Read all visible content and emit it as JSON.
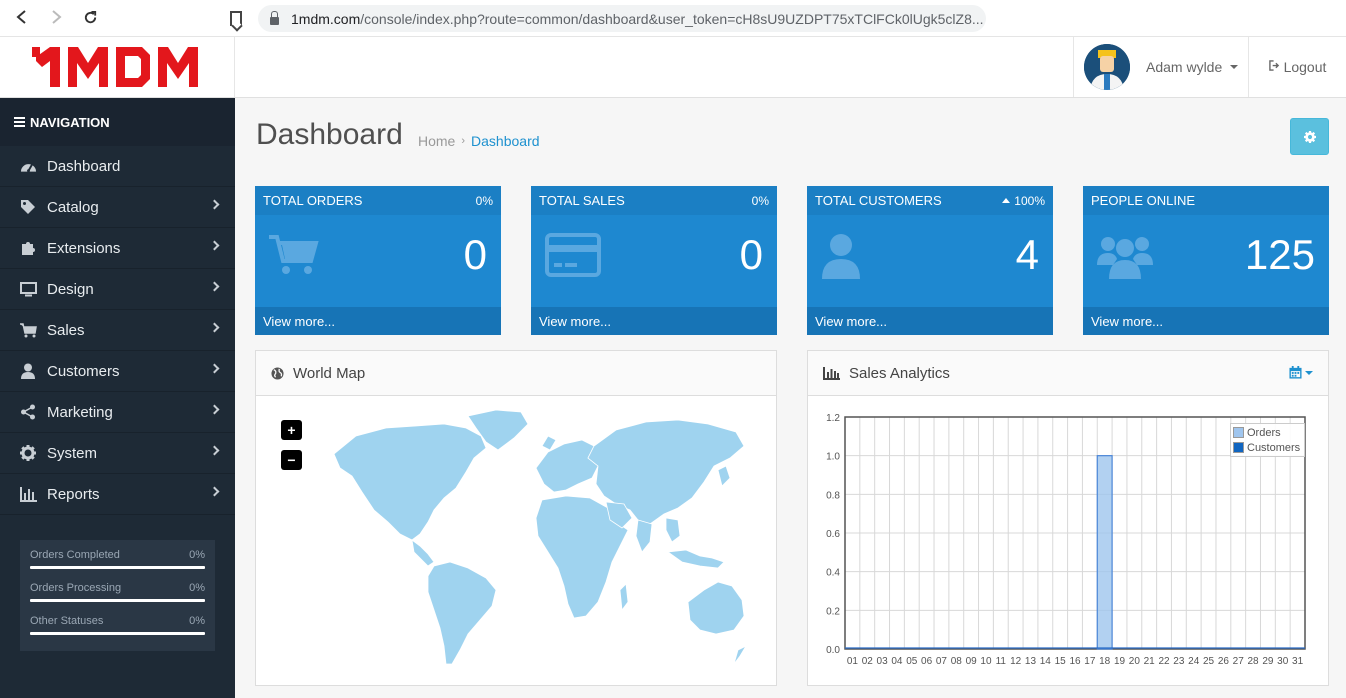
{
  "browser": {
    "url_host": "1mdm.com",
    "url_rest": "/console/index.php?route=common/dashboard&user_token=cH8sU9UZDPT75xTClFCk0lUgk5clZ8..."
  },
  "header": {
    "logo_text": "1MDM",
    "user_name": "Adam wylde",
    "logout_label": "Logout"
  },
  "sidebar": {
    "heading": "NAVIGATION",
    "items": [
      {
        "label": "Dashboard",
        "icon": "dashboard-icon"
      },
      {
        "label": "Catalog",
        "icon": "tags-icon"
      },
      {
        "label": "Extensions",
        "icon": "puzzle-icon"
      },
      {
        "label": "Design",
        "icon": "monitor-icon"
      },
      {
        "label": "Sales",
        "icon": "cart-icon"
      },
      {
        "label": "Customers",
        "icon": "user-icon"
      },
      {
        "label": "Marketing",
        "icon": "share-icon"
      },
      {
        "label": "System",
        "icon": "gear-icon"
      },
      {
        "label": "Reports",
        "icon": "bar-chart-icon"
      }
    ],
    "statuses": [
      {
        "label": "Orders Completed",
        "value": "0%"
      },
      {
        "label": "Orders Processing",
        "value": "0%"
      },
      {
        "label": "Other Statuses",
        "value": "0%"
      }
    ]
  },
  "main": {
    "title": "Dashboard",
    "breadcrumb": {
      "home": "Home",
      "current": "Dashboard"
    },
    "tiles": [
      {
        "title": "TOTAL ORDERS",
        "pct": "0%",
        "value": "0",
        "footer": "View more...",
        "icon": "cart-icon"
      },
      {
        "title": "TOTAL SALES",
        "pct": "0%",
        "value": "0",
        "footer": "View more...",
        "icon": "credit-card-icon"
      },
      {
        "title": "TOTAL CUSTOMERS",
        "pct": "100%",
        "value": "4",
        "footer": "View more...",
        "icon": "user-icon"
      },
      {
        "title": "PEOPLE ONLINE",
        "pct": "",
        "value": "125",
        "footer": "View more...",
        "icon": "users-icon"
      }
    ],
    "map_panel": {
      "title": "World Map",
      "zoom_in": "+",
      "zoom_out": "−"
    },
    "chart_panel": {
      "title": "Sales Analytics"
    }
  },
  "colors": {
    "accent": "#1e91cf",
    "tile": "#1e88d0",
    "sidebar": "#1e2a36",
    "map_land": "#9fd3ef",
    "orders_series": "#9fc5ee",
    "customers_series": "#1065c0"
  },
  "chart_data": {
    "type": "bar",
    "categories": [
      "01",
      "02",
      "03",
      "04",
      "05",
      "06",
      "07",
      "08",
      "09",
      "10",
      "11",
      "12",
      "13",
      "14",
      "15",
      "16",
      "17",
      "18",
      "19",
      "20",
      "21",
      "22",
      "23",
      "24",
      "25",
      "26",
      "27",
      "28",
      "29",
      "30",
      "31"
    ],
    "series": [
      {
        "name": "Orders",
        "values": [
          0,
          0,
          0,
          0,
          0,
          0,
          0,
          0,
          0,
          0,
          0,
          0,
          0,
          0,
          0,
          0,
          0,
          1,
          0,
          0,
          0,
          0,
          0,
          0,
          0,
          0,
          0,
          0,
          0,
          0,
          0
        ]
      },
      {
        "name": "Customers",
        "values": [
          0,
          0,
          0,
          0,
          0,
          0,
          0,
          0,
          0,
          0,
          0,
          0,
          0,
          0,
          0,
          0,
          0,
          0,
          0,
          0,
          0,
          0,
          0,
          0,
          0,
          0,
          0,
          0,
          0,
          0,
          0
        ]
      }
    ],
    "yticks": [
      "0.0",
      "0.2",
      "0.4",
      "0.6",
      "0.8",
      "1.0",
      "1.2"
    ],
    "ylim": [
      0,
      1.2
    ],
    "grid": true,
    "legend": "top-right",
    "title": "",
    "xlabel": "",
    "ylabel": ""
  }
}
